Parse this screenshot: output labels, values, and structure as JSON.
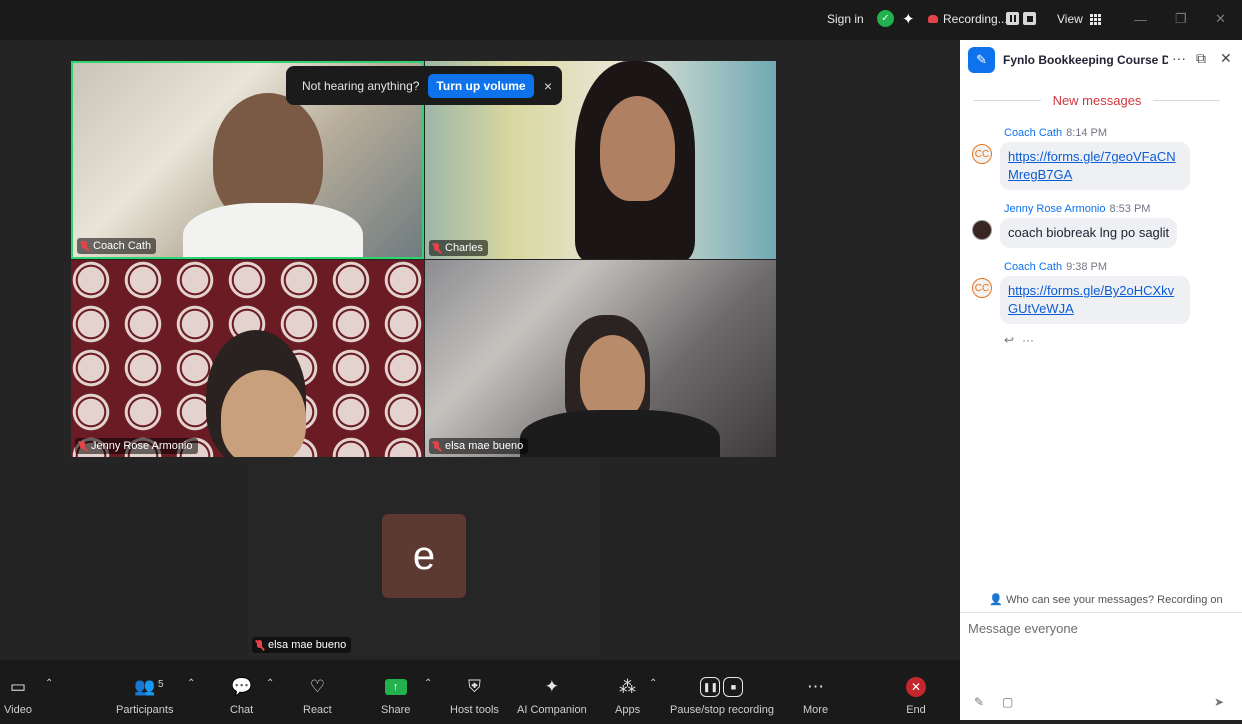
{
  "titlebar": {
    "sign_in": "Sign in",
    "recording": "Recording...",
    "view": "View"
  },
  "toast": {
    "message": "Not hearing anything?",
    "button": "Turn up volume",
    "close": "×"
  },
  "tiles": [
    {
      "name": "Coach Cath"
    },
    {
      "name": "Charles"
    },
    {
      "name": "Jenny Rose Armonio"
    },
    {
      "name": "elsa mae bueno"
    },
    {
      "name": "elsa mae bueno",
      "initial": "e"
    }
  ],
  "chat": {
    "title": "Fynlo Bookkeeping Course D...",
    "new_messages": "New messages",
    "messages": [
      {
        "sender": "Coach Cath",
        "time": "8:14 PM",
        "avatar": "CC",
        "text": "https://forms.gle/7geoVFaCN\nMregB7GA",
        "line1": "https://forms.gle/7geoVFaCN",
        "line2": "MregB7GA"
      },
      {
        "sender": "Jenny Rose Armonio",
        "time": "8:53 PM",
        "avatar": "",
        "text": "coach biobreak lng po saglit"
      },
      {
        "sender": "Coach Cath",
        "time": "9:38 PM",
        "avatar": "CC",
        "line1": "https://forms.gle/By2oHCXkv",
        "line2": "GUtVeWJA"
      }
    ],
    "privacy": "Who can see your messages? Recording on",
    "input_placeholder": "Message everyone"
  },
  "toolbar": {
    "video": "Video",
    "participants": "Participants",
    "participants_count": "5",
    "chat": "Chat",
    "react": "React",
    "share": "Share",
    "host_tools": "Host tools",
    "ai_companion": "AI Companion",
    "apps": "Apps",
    "pause_stop": "Pause/stop recording",
    "more": "More",
    "end": "End"
  }
}
